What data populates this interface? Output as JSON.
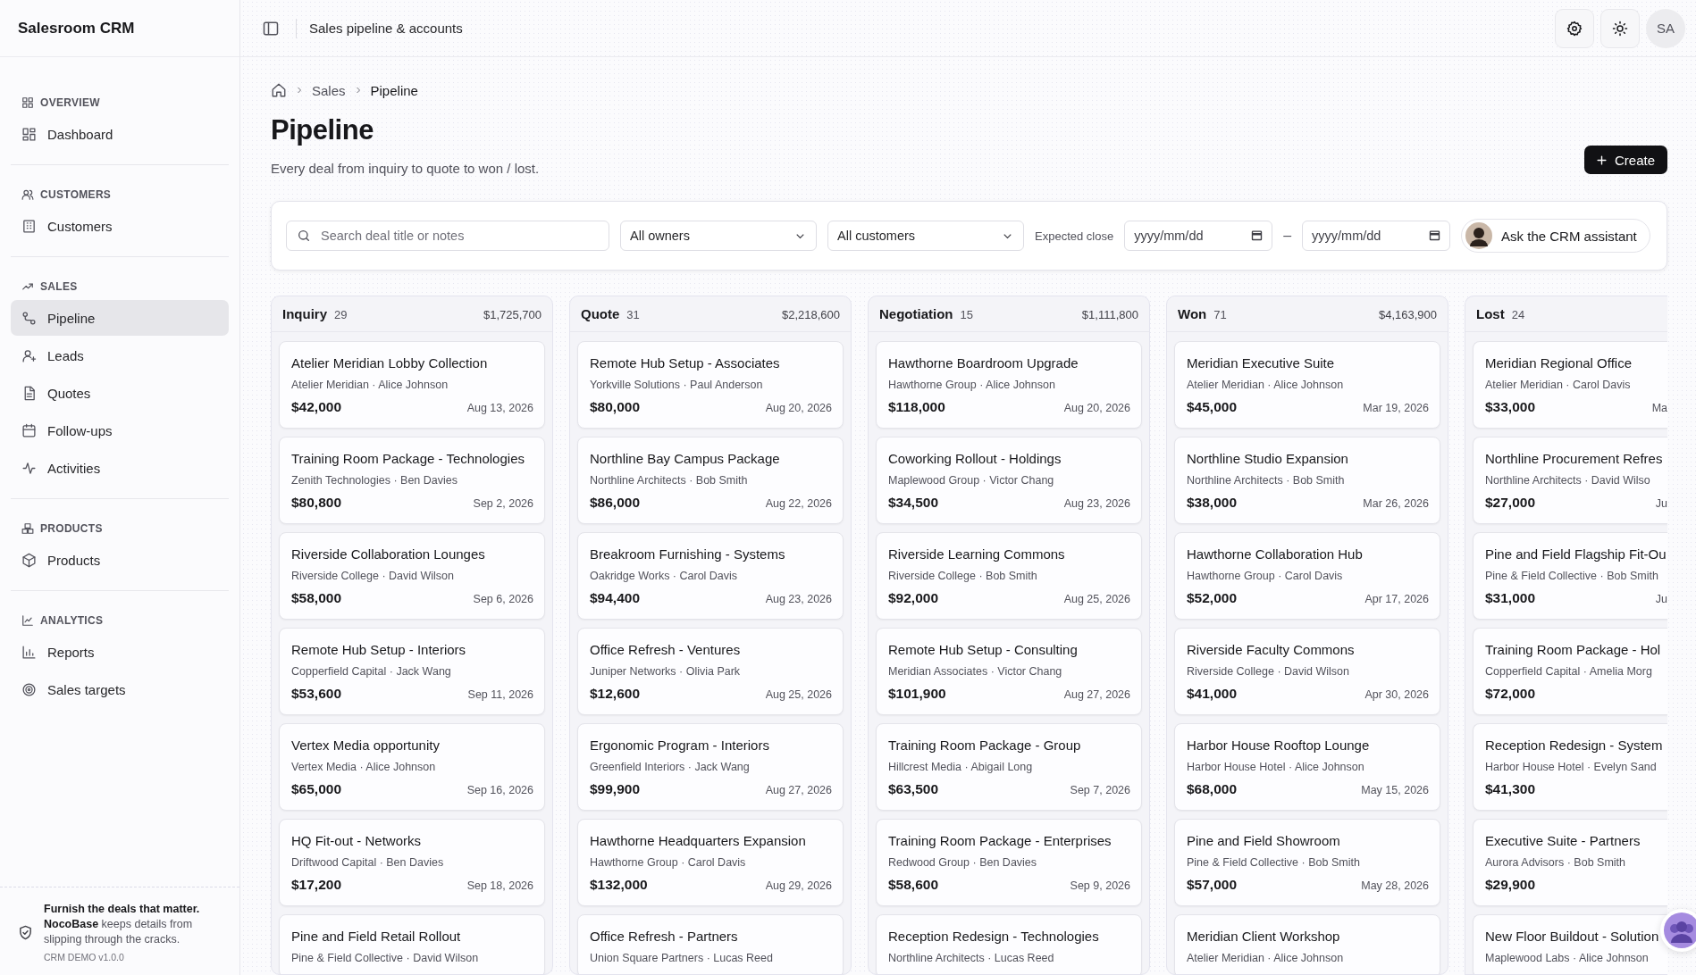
{
  "app": {
    "name": "Salesroom CRM"
  },
  "header": {
    "title": "Sales pipeline & accounts",
    "avatar": "SA"
  },
  "sidebar": {
    "sections": [
      {
        "label": "OVERVIEW",
        "items": [
          {
            "label": "Dashboard",
            "selected": false
          }
        ]
      },
      {
        "label": "CUSTOMERS",
        "items": [
          {
            "label": "Customers",
            "selected": false
          }
        ]
      },
      {
        "label": "SALES",
        "items": [
          {
            "label": "Pipeline",
            "selected": true
          },
          {
            "label": "Leads",
            "selected": false
          },
          {
            "label": "Quotes",
            "selected": false
          },
          {
            "label": "Follow-ups",
            "selected": false
          },
          {
            "label": "Activities",
            "selected": false
          }
        ]
      },
      {
        "label": "PRODUCTS",
        "items": [
          {
            "label": "Products",
            "selected": false
          }
        ]
      },
      {
        "label": "ANALYTICS",
        "items": [
          {
            "label": "Reports",
            "selected": false
          },
          {
            "label": "Sales targets",
            "selected": false
          }
        ]
      }
    ],
    "footer": {
      "text": "**Furnish the deals that matter.** **NocoBase** keeps details from slipping through the cracks.",
      "version": "CRM DEMO v1.0.0"
    }
  },
  "breadcrumb": [
    "Sales",
    "Pipeline"
  ],
  "page": {
    "title": "Pipeline",
    "subtitle": "Every deal from inquiry to quote to won / lost.",
    "create_button": "Create"
  },
  "filters": {
    "search": {
      "placeholder": "Search deal title or notes"
    },
    "owner": "All owners",
    "customer": "All customers",
    "date_label": "Expected close",
    "date_from": {
      "placeholder": "yyyy/mm/dd"
    },
    "date_separator": "–",
    "date_to": {
      "placeholder": "yyyy/mm/dd"
    },
    "assistant_button": "Ask the CRM assistant"
  },
  "board": {
    "columns": [
      {
        "name": "Inquiry",
        "count": "29",
        "total": "$1,725,700",
        "cards": [
          {
            "title": "Atelier Meridian Lobby Collection",
            "subtitle": "Atelier Meridian · Alice Johnson",
            "amount": "$42,000",
            "date": "Aug 13, 2026"
          },
          {
            "title": "Training Room Package - Technologies",
            "subtitle": "Zenith Technologies · Ben Davies",
            "amount": "$80,800",
            "date": "Sep 2, 2026"
          },
          {
            "title": "Riverside Collaboration Lounges",
            "subtitle": "Riverside College · David Wilson",
            "amount": "$58,000",
            "date": "Sep 6, 2026"
          },
          {
            "title": "Remote Hub Setup - Interiors",
            "subtitle": "Copperfield Capital · Jack Wang",
            "amount": "$53,600",
            "date": "Sep 11, 2026"
          },
          {
            "title": "Vertex Media opportunity",
            "subtitle": "Vertex Media · Alice Johnson",
            "amount": "$65,000",
            "date": "Sep 16, 2026"
          },
          {
            "title": "HQ Fit-out - Networks",
            "subtitle": "Driftwood Capital · Ben Davies",
            "amount": "$17,200",
            "date": "Sep 18, 2026"
          },
          {
            "title": "Pine and Field Retail Rollout",
            "subtitle": "Pine & Field Collective · David Wilson"
          }
        ]
      },
      {
        "name": "Quote",
        "count": "31",
        "total": "$2,218,600",
        "cards": [
          {
            "title": "Remote Hub Setup - Associates",
            "subtitle": "Yorkville Solutions · Paul Anderson",
            "amount": "$80,000",
            "date": "Aug 20, 2026"
          },
          {
            "title": "Northline Bay Campus Package",
            "subtitle": "Northline Architects · Bob Smith",
            "amount": "$86,000",
            "date": "Aug 22, 2026"
          },
          {
            "title": "Breakroom Furnishing - Systems",
            "subtitle": "Oakridge Works · Carol Davis",
            "amount": "$94,400",
            "date": "Aug 23, 2026"
          },
          {
            "title": "Office Refresh - Ventures",
            "subtitle": "Juniper Networks · Olivia Park",
            "amount": "$12,600",
            "date": "Aug 25, 2026"
          },
          {
            "title": "Ergonomic Program - Interiors",
            "subtitle": "Greenfield Interiors · Jack Wang",
            "amount": "$99,900",
            "date": "Aug 27, 2026"
          },
          {
            "title": "Hawthorne Headquarters Expansion",
            "subtitle": "Hawthorne Group · Carol Davis",
            "amount": "$132,000",
            "date": "Aug 29, 2026"
          },
          {
            "title": "Office Refresh - Partners",
            "subtitle": "Union Square Partners · Lucas Reed"
          }
        ]
      },
      {
        "name": "Negotiation",
        "count": "15",
        "total": "$1,111,800",
        "cards": [
          {
            "title": "Hawthorne Boardroom Upgrade",
            "subtitle": "Hawthorne Group · Alice Johnson",
            "amount": "$118,000",
            "date": "Aug 20, 2026"
          },
          {
            "title": "Coworking Rollout - Holdings",
            "subtitle": "Maplewood Group · Victor Chang",
            "amount": "$34,500",
            "date": "Aug 23, 2026"
          },
          {
            "title": "Riverside Learning Commons",
            "subtitle": "Riverside College · Bob Smith",
            "amount": "$92,000",
            "date": "Aug 25, 2026"
          },
          {
            "title": "Remote Hub Setup - Consulting",
            "subtitle": "Meridian Associates · Victor Chang",
            "amount": "$101,900",
            "date": "Aug 27, 2026"
          },
          {
            "title": "Training Room Package - Group",
            "subtitle": "Hillcrest Media · Abigail Long",
            "amount": "$63,500",
            "date": "Sep 7, 2026"
          },
          {
            "title": "Training Room Package - Enterprises",
            "subtitle": "Redwood Group · Ben Davies",
            "amount": "$58,600",
            "date": "Sep 9, 2026"
          },
          {
            "title": "Reception Redesign - Technologies",
            "subtitle": "Northline Architects · Lucas Reed"
          }
        ]
      },
      {
        "name": "Won",
        "count": "71",
        "total": "$4,163,900",
        "cards": [
          {
            "title": "Meridian Executive Suite",
            "subtitle": "Atelier Meridian · Alice Johnson",
            "amount": "$45,000",
            "date": "Mar 19, 2026"
          },
          {
            "title": "Northline Studio Expansion",
            "subtitle": "Northline Architects · Bob Smith",
            "amount": "$38,000",
            "date": "Mar 26, 2026"
          },
          {
            "title": "Hawthorne Collaboration Hub",
            "subtitle": "Hawthorne Group · Carol Davis",
            "amount": "$52,000",
            "date": "Apr 17, 2026"
          },
          {
            "title": "Riverside Faculty Commons",
            "subtitle": "Riverside College · David Wilson",
            "amount": "$41,000",
            "date": "Apr 30, 2026"
          },
          {
            "title": "Harbor House Rooftop Lounge",
            "subtitle": "Harbor House Hotel · Alice Johnson",
            "amount": "$68,000",
            "date": "May 15, 2026"
          },
          {
            "title": "Pine and Field Showroom",
            "subtitle": "Pine & Field Collective · Bob Smith",
            "amount": "$57,000",
            "date": "May 28, 2026"
          },
          {
            "title": "Meridian Client Workshop",
            "subtitle": "Atelier Meridian · Alice Johnson"
          }
        ]
      },
      {
        "name": "Lost",
        "count": "24",
        "cards": [
          {
            "title": "Meridian Regional Office",
            "subtitle": "Atelier Meridian · Carol Davis",
            "amount": "$33,000",
            "date": "Ma"
          },
          {
            "title": "Northline Procurement Refres",
            "subtitle": "Northline Architects · David Wilso",
            "amount": "$27,000",
            "date": "Ju"
          },
          {
            "title": "Pine and Field Flagship Fit-Ou",
            "subtitle": "Pine & Field Collective · Bob Smith",
            "amount": "$31,000",
            "date": "Ju"
          },
          {
            "title": "Training Room Package - Hol",
            "subtitle": "Copperfield Capital · Amelia Morg",
            "amount": "$72,000"
          },
          {
            "title": "Reception Redesign - System",
            "subtitle": "Harbor House Hotel · Evelyn Sand",
            "amount": "$41,300"
          },
          {
            "title": "Executive Suite - Partners",
            "subtitle": "Aurora Advisors · Bob Smith",
            "amount": "$29,900"
          },
          {
            "title": "New Floor Buildout - Solution",
            "subtitle": "Maplewood Labs · Alice Johnson"
          }
        ]
      }
    ]
  }
}
